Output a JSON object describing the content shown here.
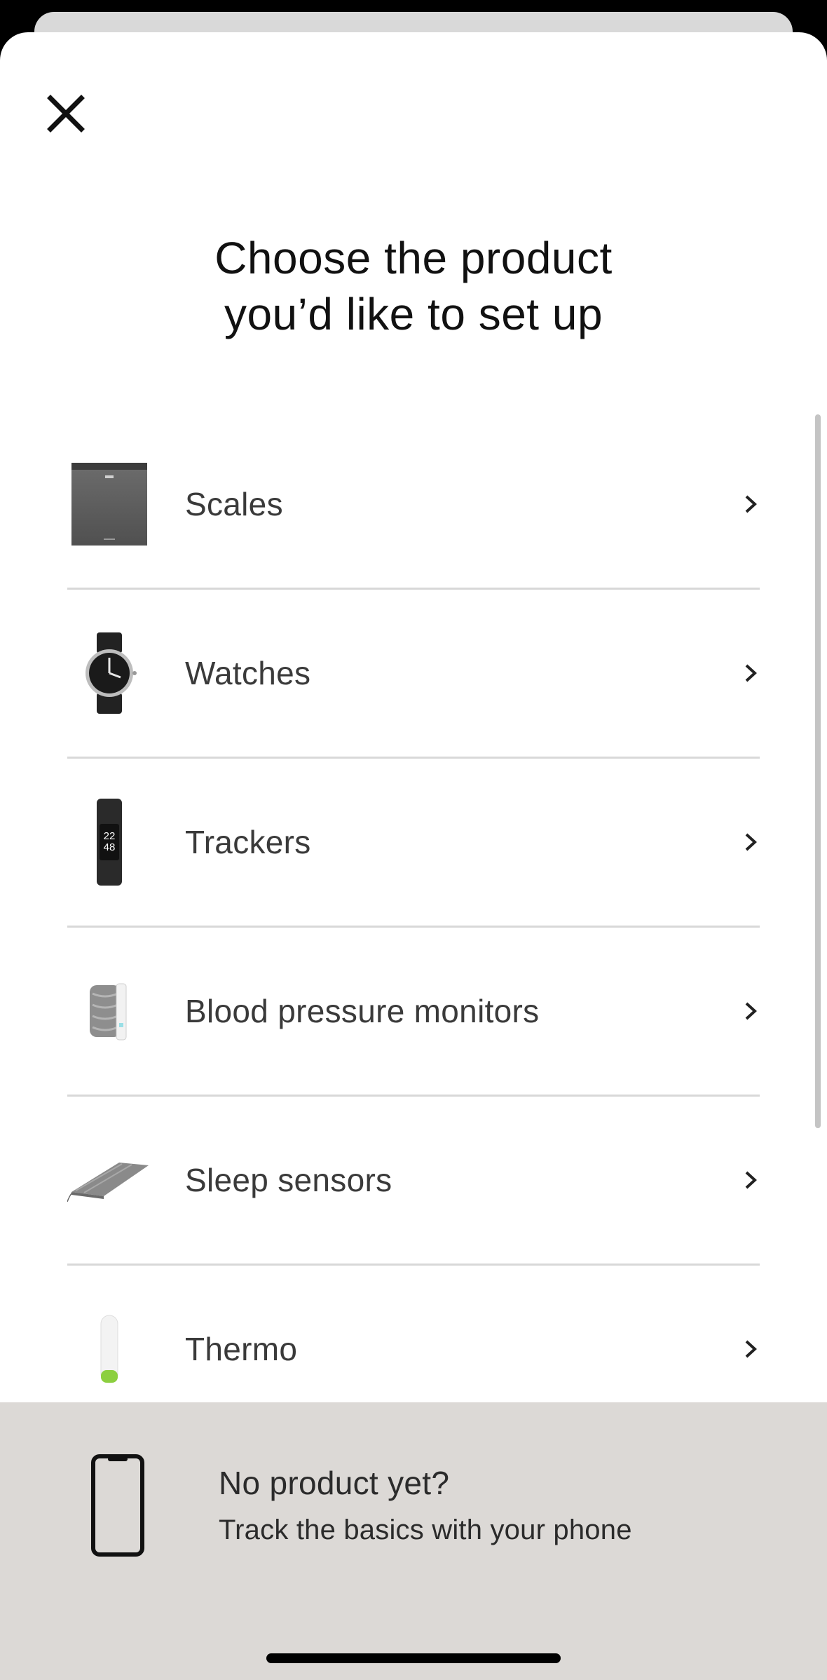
{
  "title_lines": [
    "Choose the product",
    "you’d like to set up"
  ],
  "close": {
    "icon": "close-icon"
  },
  "products": [
    {
      "label": "Scales",
      "icon": "scale-icon"
    },
    {
      "label": "Watches",
      "icon": "watch-icon"
    },
    {
      "label": "Trackers",
      "icon": "tracker-icon"
    },
    {
      "label": "Blood pressure monitors",
      "icon": "blood-pressure-monitor-icon"
    },
    {
      "label": "Sleep sensors",
      "icon": "sleep-sensor-icon"
    },
    {
      "label": "Thermo",
      "icon": "thermometer-icon"
    }
  ],
  "tracker_screen": [
    "22",
    "48"
  ],
  "footer": {
    "title": "No product yet?",
    "subtitle": "Track the basics with your phone",
    "icon": "phone-icon"
  },
  "colors": {
    "sheet": "#ffffff",
    "footer": "#dcd9d6",
    "text": "#3a3a3a",
    "divider": "#d8d8d8"
  }
}
